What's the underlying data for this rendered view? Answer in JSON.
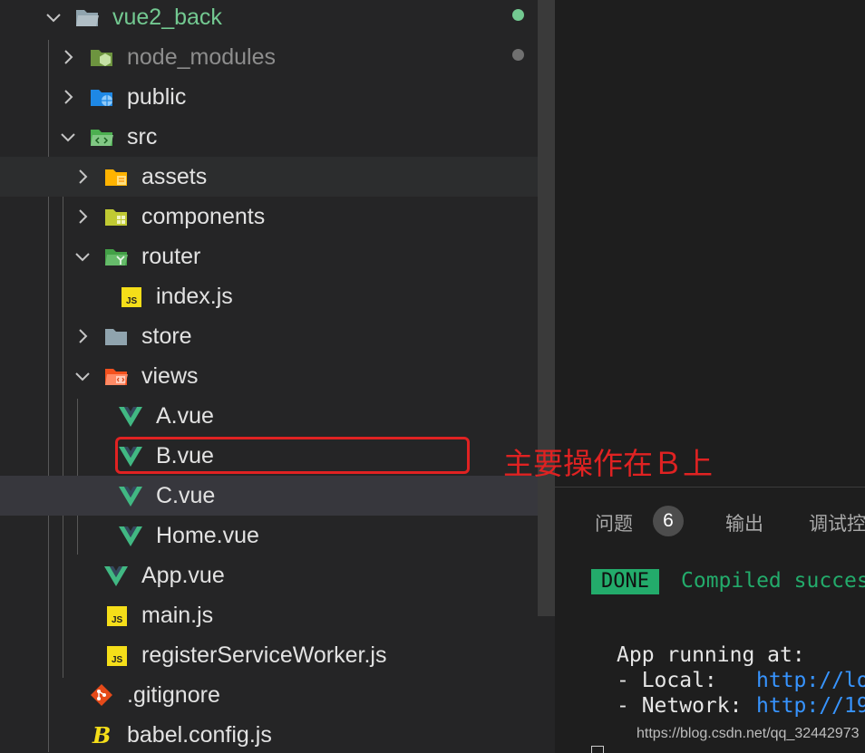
{
  "explorer": {
    "items": [
      {
        "label": "vue2_back",
        "icon": "folder-open-icon",
        "git_status": "modified",
        "expanded": true
      },
      {
        "label": "node_modules",
        "icon": "node-folder-icon",
        "ignored": true
      },
      {
        "label": "public",
        "icon": "public-folder-icon"
      },
      {
        "label": "src",
        "icon": "src-folder-icon",
        "expanded": true
      },
      {
        "label": "assets",
        "icon": "assets-folder-icon"
      },
      {
        "label": "components",
        "icon": "components-folder-icon"
      },
      {
        "label": "router",
        "icon": "router-folder-icon",
        "expanded": true
      },
      {
        "label": "index.js",
        "icon": "js-file-icon"
      },
      {
        "label": "store",
        "icon": "store-folder-icon"
      },
      {
        "label": "views",
        "icon": "views-folder-icon",
        "expanded": true
      },
      {
        "label": "A.vue",
        "icon": "vue-file-icon"
      },
      {
        "label": "B.vue",
        "icon": "vue-file-icon",
        "highlighted": true
      },
      {
        "label": "C.vue",
        "icon": "vue-file-icon",
        "hovered": true
      },
      {
        "label": "Home.vue",
        "icon": "vue-file-icon"
      },
      {
        "label": "App.vue",
        "icon": "vue-file-icon"
      },
      {
        "label": "main.js",
        "icon": "js-file-icon"
      },
      {
        "label": "registerServiceWorker.js",
        "icon": "js-file-icon"
      },
      {
        "label": ".gitignore",
        "icon": "git-file-icon"
      },
      {
        "label": "babel.config.js",
        "icon": "babel-file-icon"
      }
    ]
  },
  "panel": {
    "tabs": [
      {
        "label": "问题",
        "badge": "6"
      },
      {
        "label": "输出"
      },
      {
        "label": "调试控"
      }
    ],
    "terminal": {
      "done_tag": "DONE",
      "compiled_text": "Compiled succes",
      "app_running": "App running at:",
      "local_label": "- Local:",
      "local_url": "http://lo",
      "network_label": "- Network:",
      "network_url": "http://19"
    }
  },
  "annotation": {
    "text": "主要操作在Ｂ上",
    "color": "#e02222"
  },
  "watermark": "https://blog.csdn.net/qq_32442973",
  "colors": {
    "sidebar_bg": "#252526",
    "editor_bg": "#1e1e1e",
    "git_modified": "#73c991",
    "done_green": "#23ab6b",
    "link_blue": "#3794ff",
    "vue_green": "#41b883",
    "js_yellow": "#f5de19"
  }
}
